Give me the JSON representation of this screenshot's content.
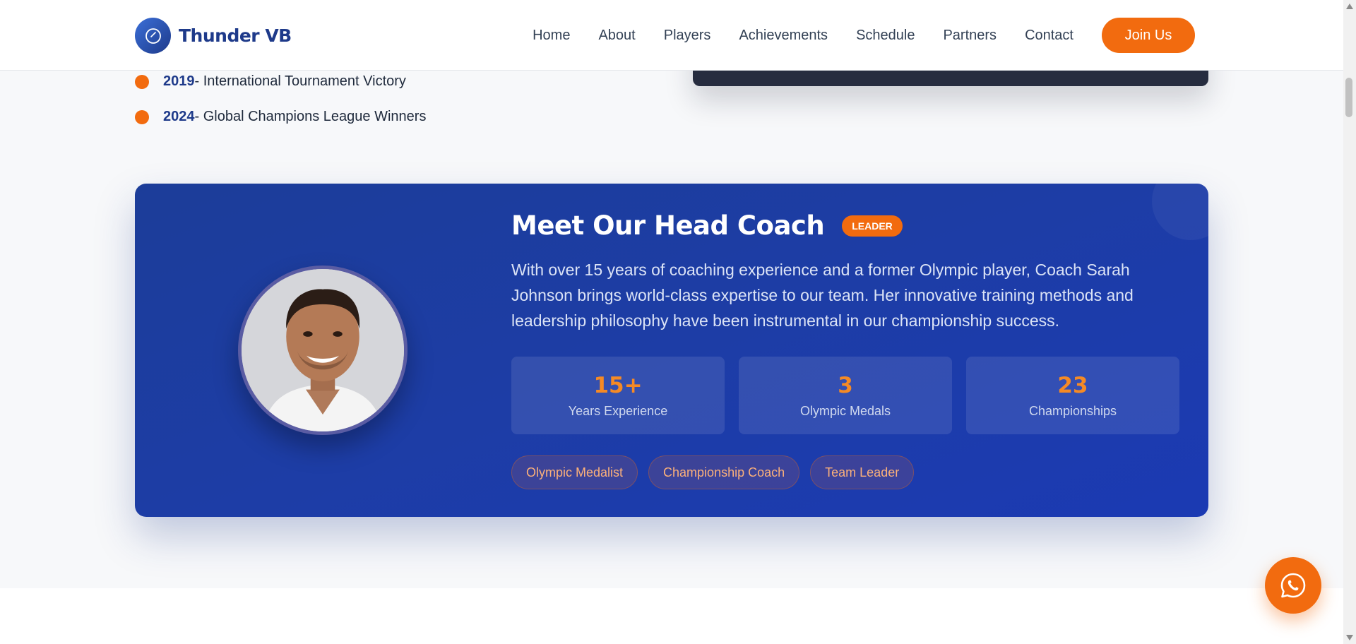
{
  "brand": {
    "name": "Thunder VB",
    "logo_icon": "volleyball-icon"
  },
  "nav": {
    "items": [
      {
        "label": "Home"
      },
      {
        "label": "About"
      },
      {
        "label": "Players"
      },
      {
        "label": "Achievements"
      },
      {
        "label": "Schedule"
      },
      {
        "label": "Partners"
      },
      {
        "label": "Contact"
      }
    ],
    "cta": "Join Us"
  },
  "history": [
    {
      "year": "2019",
      "text": " - International Tournament Victory"
    },
    {
      "year": "2024",
      "text": " - Global Champions League Winners"
    }
  ],
  "coach": {
    "title": "Meet Our Head Coach",
    "badge": "LEADER",
    "description": "With over 15 years of coaching experience and a former Olympic player, Coach Sarah Johnson brings world-class expertise to our team. Her innovative training methods and leadership philosophy have been instrumental in our championship success.",
    "stats": [
      {
        "value": "15+",
        "label": "Years Experience"
      },
      {
        "value": "3",
        "label": "Olympic Medals"
      },
      {
        "value": "23",
        "label": "Championships"
      }
    ],
    "tags": [
      "Olympic Medalist",
      "Championship Coach",
      "Team Leader"
    ]
  },
  "floating": {
    "icon": "whatsapp-icon"
  },
  "colors": {
    "accent": "#f26b0f",
    "brand": "#1e3a8a",
    "card": "#1d3da6"
  }
}
